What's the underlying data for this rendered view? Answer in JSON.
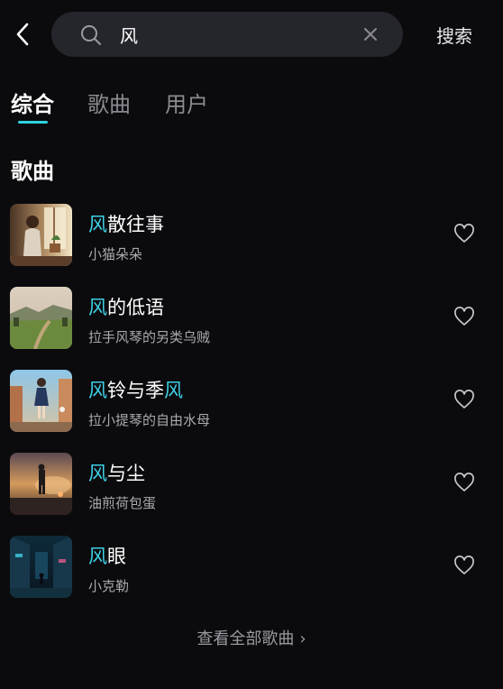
{
  "search": {
    "query": "风",
    "submit_label": "搜索",
    "back_icon": "chevron-left-icon",
    "search_icon": "search-icon",
    "clear_icon": "close-icon"
  },
  "tabs": [
    {
      "label": "综合",
      "active": true
    },
    {
      "label": "歌曲",
      "active": false
    },
    {
      "label": "用户",
      "active": false
    }
  ],
  "section": {
    "title": "歌曲"
  },
  "songs": [
    {
      "title_parts": [
        {
          "text": "风",
          "hl": true
        },
        {
          "text": "散往事",
          "hl": false
        }
      ],
      "artist": "小猫朵朵",
      "cover": "girl-by-window"
    },
    {
      "title_parts": [
        {
          "text": "风",
          "hl": true
        },
        {
          "text": "的低语",
          "hl": false
        }
      ],
      "artist": "拉手风琴的另类乌贼",
      "cover": "meadow-landscape"
    },
    {
      "title_parts": [
        {
          "text": "风",
          "hl": true
        },
        {
          "text": "铃与季",
          "hl": false
        },
        {
          "text": "风",
          "hl": true
        }
      ],
      "artist": "拉小提琴的自由水母",
      "cover": "anime-girl-street"
    },
    {
      "title_parts": [
        {
          "text": "风",
          "hl": true
        },
        {
          "text": "与尘",
          "hl": false
        }
      ],
      "artist": "油煎荷包蛋",
      "cover": "figure-at-sunset"
    },
    {
      "title_parts": [
        {
          "text": "风",
          "hl": true
        },
        {
          "text": "眼",
          "hl": false
        }
      ],
      "artist": "小克勒",
      "cover": "neon-alley-night"
    }
  ],
  "footer": {
    "view_all_label": "查看全部歌曲",
    "chevron": "›"
  },
  "colors": {
    "accent": "#2fd3e0",
    "highlight": "#3fd0e6",
    "background": "#0b0b0e",
    "search_bg": "#25262b"
  }
}
